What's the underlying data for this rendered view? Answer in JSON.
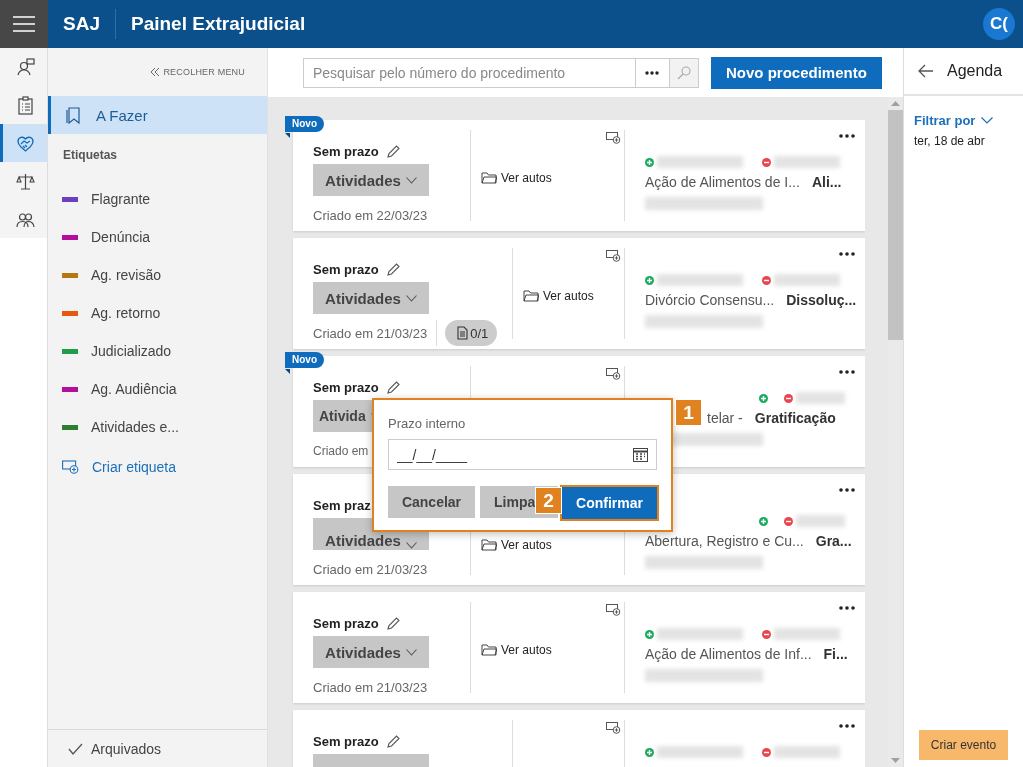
{
  "header": {
    "logo": "SAJ",
    "title": "Painel Extrajudicial",
    "avatar": "C("
  },
  "rail": [
    {
      "kind": "person-chat",
      "selected": false
    },
    {
      "kind": "clipboard",
      "selected": false
    },
    {
      "kind": "handshake",
      "selected": true
    },
    {
      "kind": "scales",
      "selected": false
    },
    {
      "kind": "people",
      "selected": false
    }
  ],
  "sidebar": {
    "collapse": "RECOLHER MENU",
    "items": [
      {
        "label": "A Fazer",
        "selected": true
      }
    ],
    "tags_heading": "Etiquetas",
    "tags": [
      {
        "label": "Flagrante",
        "color": "#6b3fc0"
      },
      {
        "label": "Denúncia",
        "color": "#b0109c"
      },
      {
        "label": "Ag. revisão",
        "color": "#b5770f"
      },
      {
        "label": "Ag. retorno",
        "color": "#e8580c"
      },
      {
        "label": "Judicializado",
        "color": "#1e9e48"
      },
      {
        "label": "Ag. Audiência",
        "color": "#b0109c"
      },
      {
        "label": "Atividades e...",
        "color": "#2e7d32"
      }
    ],
    "create_tag": "Criar etiqueta",
    "archived": "Arquivados"
  },
  "toolbar": {
    "search": {
      "placeholder": "Pesquisar pelo número do procedimento"
    },
    "new_button": "Novo procedimento"
  },
  "cards": [
    {
      "kind": "plain",
      "badge": "Novo",
      "deadline": "Sem prazo",
      "activities": "Atividades",
      "created": "Criado em 22/03/23",
      "link": "Ver autos",
      "case": "Ação de Alimentos de I...",
      "subject": "Ali..."
    },
    {
      "kind": "with-docs",
      "deadline": "Sem prazo",
      "activities": "Atividades",
      "created": "Criado em 21/03/23",
      "doc_count": "0/1",
      "link": "Ver autos",
      "case": "Divórcio Consensu...",
      "subject": "Dissoluç..."
    },
    {
      "kind": "plain",
      "badge": "Novo",
      "deadline": "Sem prazo",
      "activities": "Ativida",
      "created": "Criado em",
      "case": "telar -",
      "subject": "Gratificação"
    },
    {
      "kind": "plain",
      "deadline": "Sem praz",
      "activities": "Atividades",
      "created": "Criado em 21/03/23",
      "link": "Ver autos",
      "case": "Abertura, Registro e Cu...",
      "subject": "Gra..."
    },
    {
      "kind": "plain",
      "deadline": "Sem prazo",
      "activities": "Atividades",
      "created": "Criado em 21/03/23",
      "link": "Ver autos",
      "case": "Ação de Alimentos de Inf...",
      "subject": "Fi..."
    },
    {
      "kind": "with-docs",
      "deadline": "Sem prazo"
    }
  ],
  "dialog": {
    "label": "Prazo interno",
    "placeholder": "__/__/____",
    "buttons": [
      {
        "label": "Cancelar",
        "kind": "secondary"
      },
      {
        "label": "Limpa",
        "kind": "secondary"
      },
      {
        "label": "Confirmar",
        "kind": "primary"
      }
    ],
    "callouts": [
      "1",
      "2"
    ]
  },
  "agenda": {
    "title": "Agenda",
    "filter": "Filtrar por",
    "date": "ter, 18 de abr",
    "create_button": "Criar evento"
  }
}
